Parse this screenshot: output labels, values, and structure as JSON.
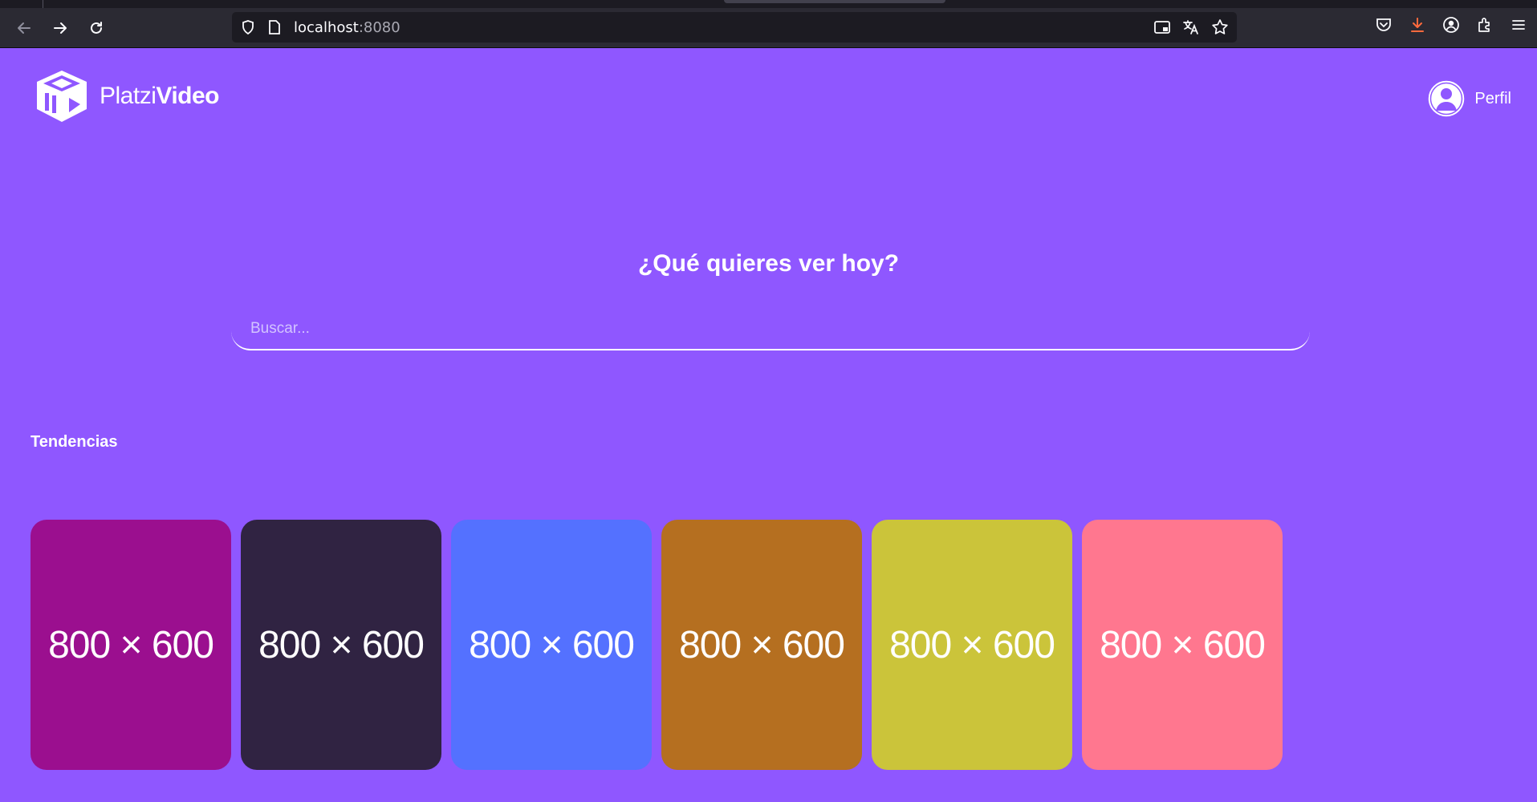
{
  "browser": {
    "url_host": "localhost",
    "url_port": ":8080"
  },
  "header": {
    "brand_light": "Platzi",
    "brand_bold": "Video",
    "profile_label": "Perfil"
  },
  "hero": {
    "title": "¿Qué quieres ver hoy?",
    "search_placeholder": "Buscar..."
  },
  "trends": {
    "title": "Tendencias",
    "items": [
      {
        "label": "800 × 600",
        "color": "#9b0f8f"
      },
      {
        "label": "800 × 600",
        "color": "#302342"
      },
      {
        "label": "800 × 600",
        "color": "#5471ff"
      },
      {
        "label": "800 × 600",
        "color": "#b56f20"
      },
      {
        "label": "800 × 600",
        "color": "#cbc43a"
      },
      {
        "label": "800 × 600",
        "color": "#ff778f"
      }
    ]
  },
  "colors": {
    "background": "#8f57ff",
    "chrome": "#2b2a33",
    "urlbar": "#1c1b22"
  }
}
